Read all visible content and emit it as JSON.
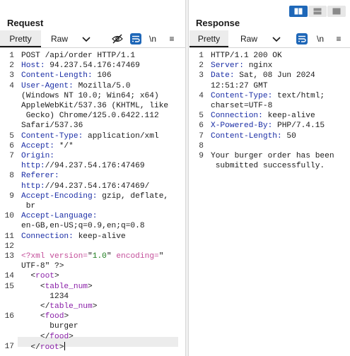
{
  "request": {
    "title": "Request",
    "tabs": [
      "Pretty",
      "Raw"
    ],
    "newline_label": "\\n",
    "icons": [
      "chevron-down-icon",
      "eye-slash-icon",
      "wrap-icon"
    ],
    "lines": [
      {
        "num": "1",
        "text": "POST /api/order HTTP/1.1"
      },
      {
        "num": "2",
        "text": "Host: 94.237.54.176:47469"
      },
      {
        "num": "3",
        "text": "Content-Length: 106"
      },
      {
        "num": "4",
        "text": "User-Agent: Mozilla/5.0"
      },
      {
        "num": "",
        "text": "(Windows NT 10.0; Win64; x64)"
      },
      {
        "num": "",
        "text": "AppleWebKit/537.36 (KHTML, like"
      },
      {
        "num": "",
        "text": " Gecko) Chrome/125.0.6422.112"
      },
      {
        "num": "",
        "text": "Safari/537.36"
      },
      {
        "num": "5",
        "text": "Content-Type: application/xml"
      },
      {
        "num": "6",
        "text": "Accept: */*"
      },
      {
        "num": "7",
        "text": "Origin:"
      },
      {
        "num": "",
        "text": "http://94.237.54.176:47469"
      },
      {
        "num": "8",
        "text": "Referer:"
      },
      {
        "num": "",
        "text": "http://94.237.54.176:47469/"
      },
      {
        "num": "9",
        "text": "Accept-Encoding: gzip, deflate,"
      },
      {
        "num": "",
        "text": " br"
      },
      {
        "num": "10",
        "text": "Accept-Language:"
      },
      {
        "num": "",
        "text": "en-GB,en-US;q=0.9,en;q=0.8"
      },
      {
        "num": "11",
        "text": "Connection: keep-alive"
      },
      {
        "num": "12",
        "text": ""
      },
      {
        "num": "13",
        "text": "<?xml version=\"1.0\" encoding=\""
      },
      {
        "num": "",
        "text": "UTF-8\" ?>"
      },
      {
        "num": "14",
        "text": "  <root>"
      },
      {
        "num": "15",
        "text": "    <table_num>"
      },
      {
        "num": "",
        "text": "      1234"
      },
      {
        "num": "",
        "text": "    </table_num>"
      },
      {
        "num": "16",
        "text": "    <food>"
      },
      {
        "num": "",
        "text": "      burger"
      },
      {
        "num": "",
        "text": "    </food>"
      },
      {
        "num": "17",
        "text": "  </root>"
      }
    ]
  },
  "response": {
    "title": "Response",
    "tabs": [
      "Pretty",
      "Raw"
    ],
    "newline_label": "\\n",
    "lines": [
      {
        "num": "1",
        "text": "HTTP/1.1 200 OK"
      },
      {
        "num": "2",
        "text": "Server: nginx"
      },
      {
        "num": "3",
        "text": "Date: Sat, 08 Jun 2024"
      },
      {
        "num": "",
        "text": "12:51:27 GMT"
      },
      {
        "num": "4",
        "text": "Content-Type: text/html;"
      },
      {
        "num": "",
        "text": "charset=UTF-8"
      },
      {
        "num": "5",
        "text": "Connection: keep-alive"
      },
      {
        "num": "6",
        "text": "X-Powered-By: PHP/7.4.15"
      },
      {
        "num": "7",
        "text": "Content-Length: 50"
      },
      {
        "num": "8",
        "text": ""
      },
      {
        "num": "9",
        "text": "Your burger order has been"
      },
      {
        "num": "",
        "text": " submitted successfully."
      }
    ]
  },
  "layout_icons": [
    "split-horizontal-icon",
    "split-vertical-icon",
    "single-pane-icon"
  ],
  "colors": {
    "accent": "#1e67b8",
    "header_key": "#1b2ea6",
    "xml_tag": "#8a1fa8",
    "xml_decl": "#c44e9a"
  }
}
